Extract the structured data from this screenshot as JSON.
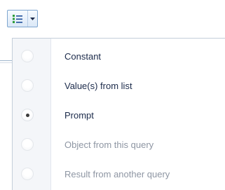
{
  "toolbar": {
    "split_button_icon": "bulleted-list-icon",
    "dropdown_icon": "dropdown-arrow-icon"
  },
  "menu": {
    "items": [
      {
        "label": "Constant",
        "checked": false,
        "enabled": true
      },
      {
        "label": "Value(s) from list",
        "checked": false,
        "enabled": true
      },
      {
        "label": "Prompt",
        "checked": true,
        "enabled": true
      },
      {
        "label": "Object from this query",
        "checked": false,
        "enabled": false
      },
      {
        "label": "Result from another query",
        "checked": false,
        "enabled": false
      }
    ]
  },
  "colors": {
    "text": "#1b2a4a",
    "disabled_text": "#8e96a3",
    "button_border": "#7ea6cf",
    "icon_green": "#2e9e3a",
    "icon_blue": "#1f4f9a"
  }
}
